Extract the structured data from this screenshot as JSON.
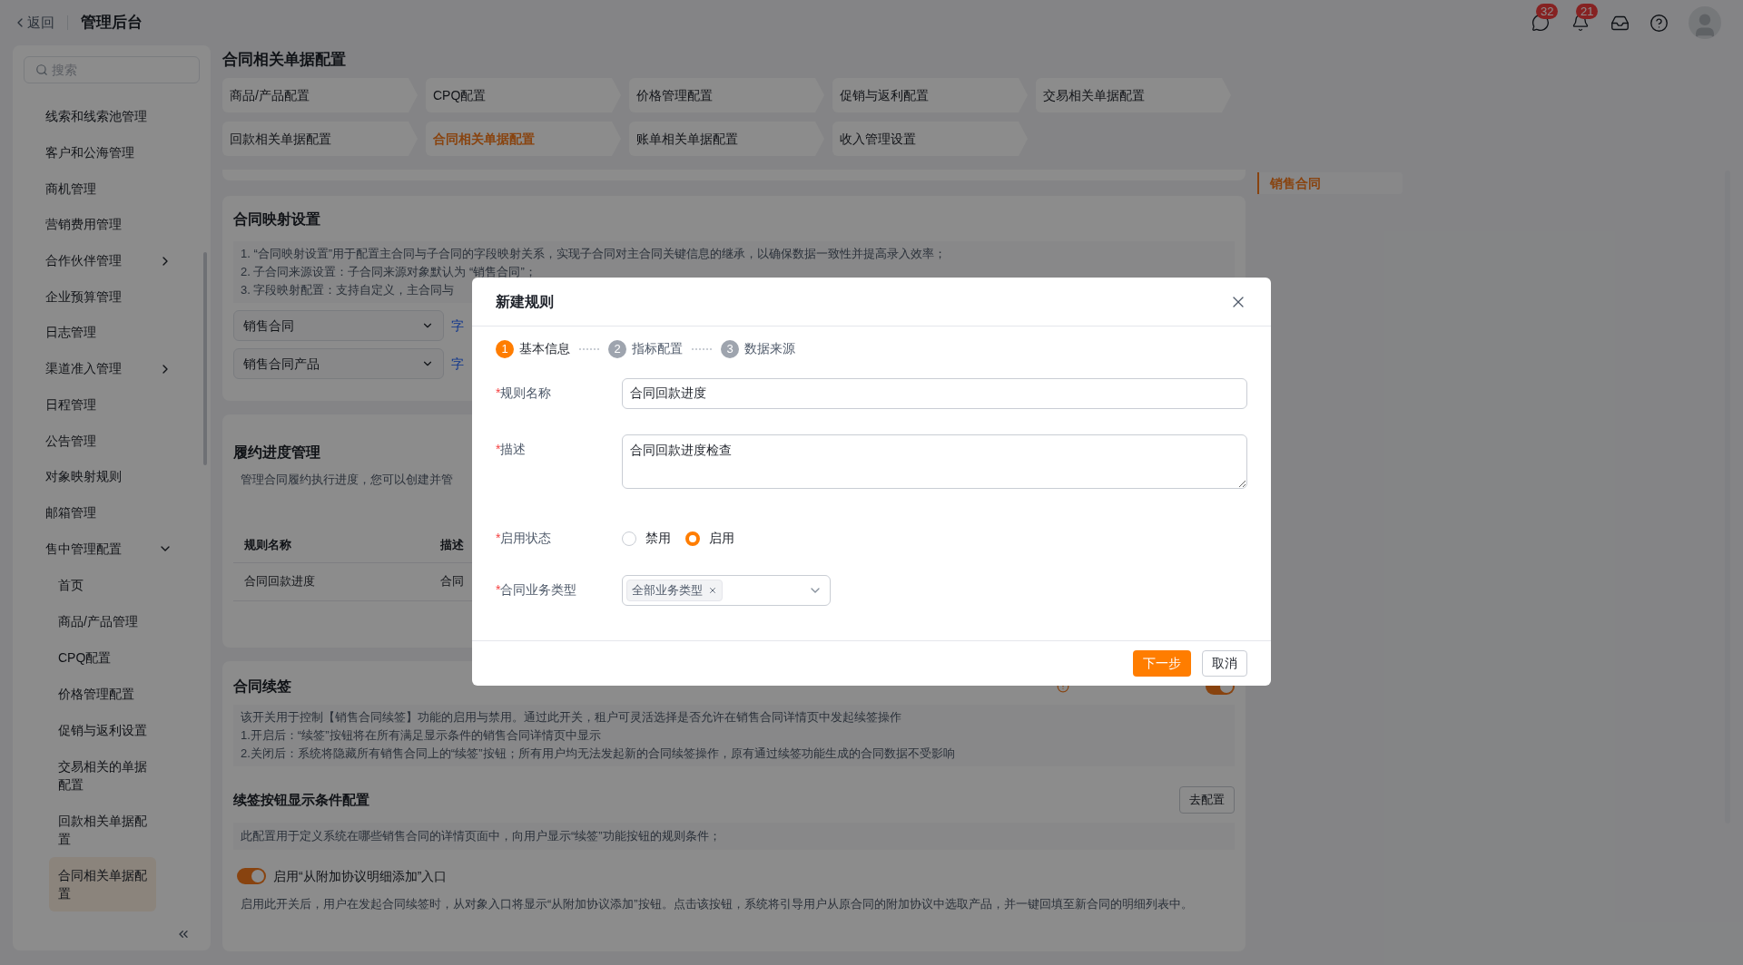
{
  "topbar": {
    "back": "返回",
    "title": "管理后台",
    "badges": [
      {
        "kind": "messages",
        "count": "32"
      },
      {
        "kind": "notifications",
        "count": "21"
      }
    ]
  },
  "sidebar": {
    "search": {
      "placeholder": "搜索"
    },
    "items": [
      {
        "label": "线索和线索池管理",
        "kind": "link",
        "selected": false
      },
      {
        "label": "客户和公海管理",
        "kind": "link",
        "selected": false
      },
      {
        "label": "商机管理",
        "kind": "link",
        "selected": false
      },
      {
        "label": "营销费用管理",
        "kind": "link",
        "selected": false
      },
      {
        "label": "合作伙伴管理",
        "kind": "group",
        "expanded": false,
        "selected": false
      },
      {
        "label": "企业预算管理",
        "kind": "link",
        "selected": false
      },
      {
        "label": "日志管理",
        "kind": "link",
        "selected": false
      },
      {
        "label": "渠道准入管理",
        "kind": "group",
        "expanded": false,
        "selected": false
      },
      {
        "label": "日程管理",
        "kind": "link",
        "selected": false
      },
      {
        "label": "公告管理",
        "kind": "link",
        "selected": false
      },
      {
        "label": "对象映射规则",
        "kind": "link",
        "selected": false
      },
      {
        "label": "邮箱管理",
        "kind": "link",
        "selected": false
      },
      {
        "label": "售中管理配置",
        "kind": "group",
        "expanded": true,
        "selected": false,
        "children": [
          {
            "label": "首页",
            "selected": false
          },
          {
            "label": "商品/产品管理",
            "selected": false
          },
          {
            "label": "CPQ配置",
            "selected": false
          },
          {
            "label": "价格管理配置",
            "selected": false
          },
          {
            "label": "促销与返利设置",
            "selected": false
          },
          {
            "label": "交易相关的单据配置",
            "selected": false
          },
          {
            "label": "回款相关单据配置",
            "selected": false
          },
          {
            "label": "合同相关单据配置",
            "selected": true
          }
        ]
      }
    ]
  },
  "page": {
    "title": "合同相关单据配置",
    "tabs": [
      {
        "label": "商品/产品配置",
        "selected": false
      },
      {
        "label": "CPQ配置",
        "selected": false
      },
      {
        "label": "价格管理配置",
        "selected": false
      },
      {
        "label": "促销与返利配置",
        "selected": false
      },
      {
        "label": "交易相关单据配置",
        "selected": false
      },
      {
        "label": "回款相关单据配置",
        "selected": false
      },
      {
        "label": "合同相关单据配置",
        "selected": true
      },
      {
        "label": "账单相关单据配置",
        "selected": false
      },
      {
        "label": "收入管理设置",
        "selected": false
      }
    ]
  },
  "anchors": [
    {
      "label": "销售合同",
      "selected": true
    }
  ],
  "mapping": {
    "title": "合同映射设置",
    "notes": [
      "1. “合同映射设置”用于配置主合同与子合同的字段映射关系，实现子合同对主合同关键信息的继承，以确保数据一致性并提高录入效率；",
      "2. 子合同来源设置：子合同来源对象默认为 “销售合同”；",
      "3. 字段映射配置：支持自定义，主合同与"
    ],
    "selects": [
      {
        "value": "销售合同",
        "link": "字"
      },
      {
        "value": "销售合同产品",
        "link": "字"
      }
    ]
  },
  "fulfillment": {
    "title": "履约进度管理",
    "description": "管理合同履约执行进度，您可以创建并管",
    "table": {
      "columns": [
        "规则名称",
        "描述"
      ],
      "rows": [
        [
          "合同回款进度",
          "合同"
        ]
      ]
    }
  },
  "renewal": {
    "title": "合同续签",
    "on": true,
    "description": [
      "该开关用于控制【销售合同续签】功能的启用与禁用。通过此开关，租户可灵活选择是否允许在销售合同详情页中发起续签操作",
      "1.开启后：“续签”按钮将在所有满足显示条件的销售合同详情页中显示",
      "2.关闭后：系统将隐藏所有销售合同上的“续签”按钮；所有用户均无法发起新的合同续签操作，原有通过续签功能生成的合同数据不受影响"
    ],
    "condition": {
      "title": "续签按钮显示条件配置",
      "button": "去配置",
      "description": "此配置用于定义系统在哪些销售合同的详情页面中，向用户显示“续签”功能按钮的规则条件；"
    },
    "addon": {
      "label": "启用“从附加协议明细添加”入口",
      "on": true,
      "description": "启用此开关后，用户在发起合同续签时，从对象入口将显示“从附加协议添加”按钮。点击该按钮，系统将引导用户从原合同的附加协议中选取产品，并一键回填至新合同的明细列表中。"
    }
  },
  "modal": {
    "title": "新建规则",
    "steps": [
      {
        "number": "1",
        "label": "基本信息",
        "selected": true
      },
      {
        "number": "2",
        "label": "指标配置",
        "selected": false
      },
      {
        "number": "3",
        "label": "数据来源",
        "selected": false
      }
    ],
    "fields": [
      {
        "kind": "input",
        "required_mark": "*",
        "label": "规则名称",
        "value": "合同回款进度"
      },
      {
        "kind": "textarea",
        "required_mark": "*",
        "label": "描述",
        "value": "合同回款进度检查"
      },
      {
        "kind": "radio",
        "required_mark": "*",
        "label": "启用状态",
        "options": [
          {
            "label": "禁用",
            "selected": false
          },
          {
            "label": "启用",
            "selected": true
          }
        ]
      },
      {
        "kind": "select",
        "required_mark": "*",
        "label": "合同业务类型",
        "tags": [
          "全部业务类型"
        ]
      }
    ],
    "buttons": {
      "next": "下一步",
      "cancel": "取消"
    }
  }
}
